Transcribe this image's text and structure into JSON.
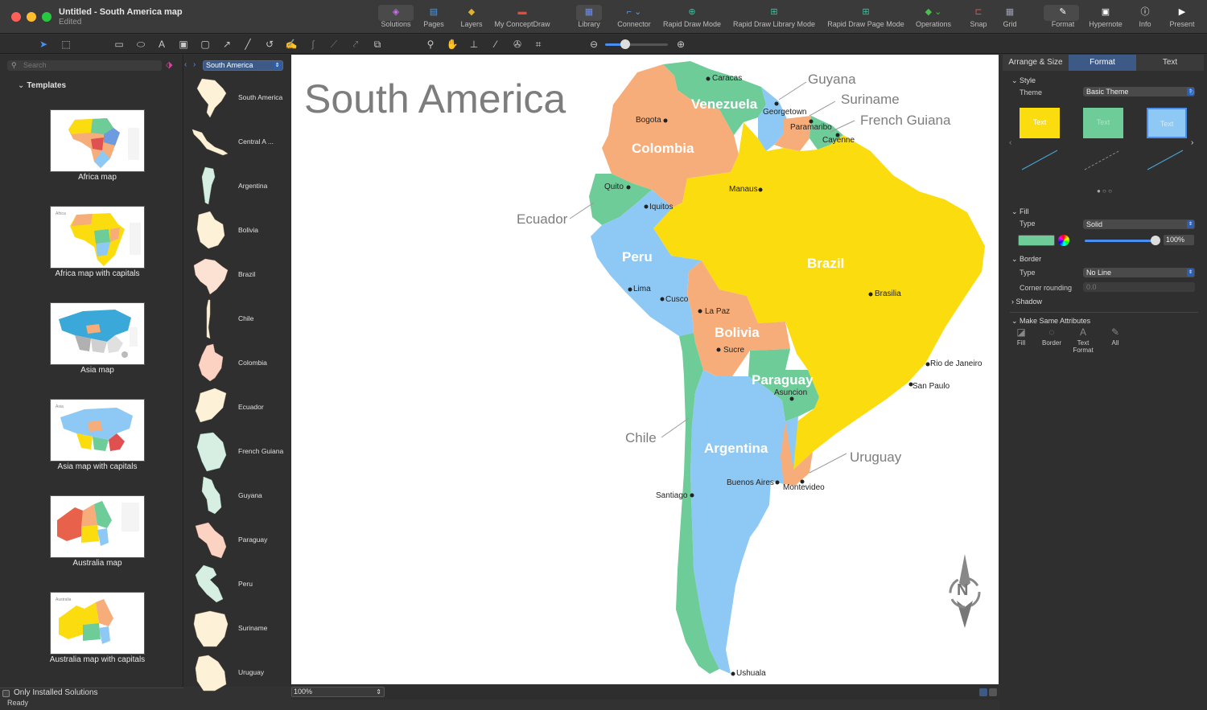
{
  "window": {
    "title": "Untitled - South America map",
    "subtitle": "Edited"
  },
  "toolbar": [
    {
      "label": "Solutions",
      "icon": "solutions-icon"
    },
    {
      "label": "Pages",
      "icon": "pages-icon"
    },
    {
      "label": "Layers",
      "icon": "layers-icon"
    },
    {
      "label": "My ConceptDraw",
      "icon": "conceptdraw-icon"
    },
    {
      "label": "Library",
      "icon": "library-icon"
    },
    {
      "label": "Connector",
      "icon": "connector-icon"
    },
    {
      "label": "Rapid Draw Mode",
      "icon": "rapid-draw-icon"
    },
    {
      "label": "Rapid Draw Library Mode",
      "icon": "rapid-draw-library-icon"
    },
    {
      "label": "Rapid Draw Page Mode",
      "icon": "rapid-draw-page-icon"
    },
    {
      "label": "Operations",
      "icon": "operations-icon"
    },
    {
      "label": "Snap",
      "icon": "snap-icon"
    },
    {
      "label": "Grid",
      "icon": "grid-icon"
    },
    {
      "label": "Format",
      "icon": "format-icon"
    },
    {
      "label": "Hypernote",
      "icon": "hypernote-icon"
    },
    {
      "label": "Info",
      "icon": "info-icon"
    },
    {
      "label": "Present",
      "icon": "present-icon"
    }
  ],
  "left_panel": {
    "search_placeholder": "Search",
    "templates_header": "Templates",
    "templates": [
      "Africa map",
      "Africa map with capitals",
      "Asia map",
      "Asia map with capitals",
      "Australia map",
      "Australia map with capitals"
    ],
    "only_installed": "Only Installed Solutions",
    "status": "Ready"
  },
  "library": {
    "selected": "South America",
    "items": [
      "South America",
      "Central A ...",
      "Argentina",
      "Bolivia",
      "Brazil",
      "Chile",
      "Colombia",
      "Ecuador",
      "French Guiana",
      "Guyana",
      "Paraguay",
      "Peru",
      "Suriname",
      "Uruguay"
    ]
  },
  "canvas": {
    "title": "South America",
    "countries": [
      "Venezuela",
      "Colombia",
      "Peru",
      "Brazil",
      "Bolivia",
      "Paraguay",
      "Argentina"
    ],
    "external_labels": [
      "Guyana",
      "Suriname",
      "French Guiana",
      "Ecuador",
      "Chile",
      "Uruguay"
    ],
    "cities": [
      "Caracas",
      "Bogota",
      "Georgetown",
      "Paramaribo",
      "Cayenne",
      "Quito",
      "Iquitos",
      "Manaus",
      "Lima",
      "Cusco",
      "La Paz",
      "Sucre",
      "Brasilia",
      "Asuncion",
      "Rio de Janeiro",
      "San Paulo",
      "Santiago",
      "Buenos Aires",
      "Montevideo",
      "Ushuala"
    ],
    "compass_letter": "N"
  },
  "zoom": "100%",
  "right_panel": {
    "tabs": [
      "Arrange & Size",
      "Format",
      "Text"
    ],
    "style_header": "Style",
    "theme_label": "Theme",
    "theme_value": "Basic Theme",
    "swatch_text": "Text",
    "fill_header": "Fill",
    "fill_type_label": "Type",
    "fill_type_value": "Solid",
    "opacity": "100%",
    "border_header": "Border",
    "border_type_label": "Type",
    "border_type_value": "No Line",
    "corner_label": "Corner rounding",
    "corner_value": "0.0",
    "shadow_label": "Shadow",
    "make_same_header": "Make Same Attributes",
    "make_same": [
      "Fill",
      "Border",
      "Text Format",
      "All"
    ]
  },
  "colors": {
    "green": "#6dcc98",
    "orange": "#f6ad7a",
    "blue": "#8ec9f5",
    "yellow": "#fbdc0f",
    "accent": "#3d5a86"
  }
}
